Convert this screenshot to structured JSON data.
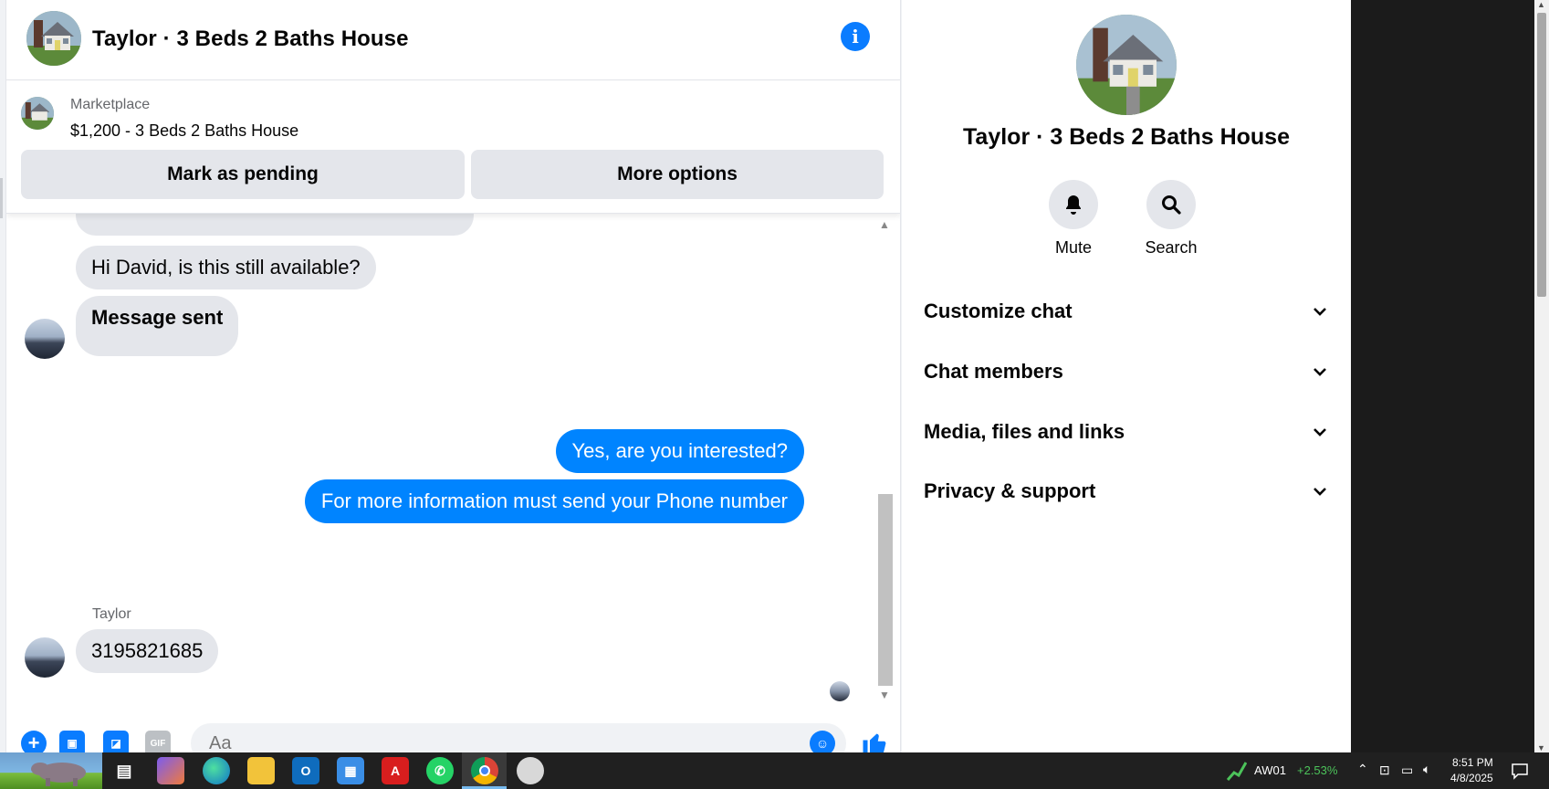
{
  "header": {
    "title": "Taylor · 3 Beds 2 Baths House"
  },
  "listing": {
    "source": "Marketplace",
    "title": "$1,200 - 3 Beds 2 Baths House",
    "pending_label": "Mark as pending",
    "options_label": "More options"
  },
  "messages": [
    {
      "direction": "incoming",
      "text": "Hi David, is this still available?"
    },
    {
      "direction": "incoming",
      "text": "Message sent"
    },
    {
      "direction": "outgoing",
      "text": "Yes, are you interested?"
    },
    {
      "direction": "outgoing",
      "text": "For more information must send your Phone number"
    },
    {
      "direction": "incoming",
      "sender": "Taylor",
      "text": "3195821685"
    }
  ],
  "composer": {
    "placeholder": "Aa"
  },
  "info_panel": {
    "title": "Taylor · 3 Beds 2 Baths House",
    "actions": [
      {
        "label": "Mute",
        "icon": "bell-icon"
      },
      {
        "label": "Search",
        "icon": "search-icon"
      }
    ],
    "sections": [
      "Customize chat",
      "Chat members",
      "Media, files and links",
      "Privacy & support"
    ]
  },
  "taskbar": {
    "stock_ticker": "AW01",
    "stock_change": "+2.53%",
    "time": "8:51 PM",
    "date": "4/8/2025",
    "apps": [
      "task-view",
      "copilot",
      "edge",
      "file-explorer",
      "outlook",
      "microsoft-store",
      "adobe-acrobat",
      "whatsapp",
      "chrome",
      "snipping-tool"
    ]
  },
  "colors": {
    "messenger_blue": "#0084ff",
    "incoming_bubble": "#e4e6eb",
    "info_blue": "#0a7cff",
    "stock_green": "#4cc35a"
  }
}
